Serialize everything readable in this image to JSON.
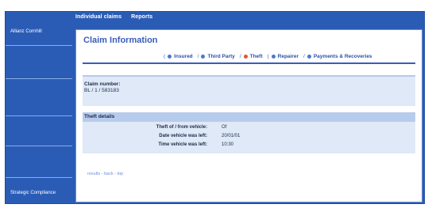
{
  "topnav": {
    "links": [
      "Individual claims",
      "Reports"
    ]
  },
  "sidebar": {
    "items": [
      {
        "label": "Allianz Cornhill"
      },
      {
        "label": ""
      },
      {
        "label": ""
      },
      {
        "label": ""
      },
      {
        "label": ""
      },
      {
        "label": "Strategic Compliance"
      }
    ]
  },
  "main": {
    "title": "Claim Information",
    "tabs": [
      {
        "label": "Insured",
        "active": false
      },
      {
        "label": "Third Party",
        "active": false
      },
      {
        "label": "Theft",
        "active": true
      },
      {
        "label": "Repairer",
        "active": false
      },
      {
        "label": "Payments & Recoveries",
        "active": false
      }
    ],
    "claim": {
      "label": "Claim number:",
      "value": "BL / 1 / 583183"
    },
    "theft": {
      "header": "Theft details",
      "rows": [
        {
          "key": "Theft of / from vehicle:",
          "value": "Of"
        },
        {
          "key": "Date vehicle was left:",
          "value": "20/01/01"
        },
        {
          "key": "Time vehicle was left:",
          "value": "10:30"
        }
      ]
    },
    "bottom_links": "results - back - top"
  },
  "colors": {
    "frame": "#2a5cb6",
    "title": "#3b5db8",
    "active_tab": "#e8532d",
    "panel": "#dfe9f7",
    "panel_header": "#b7cbec"
  }
}
